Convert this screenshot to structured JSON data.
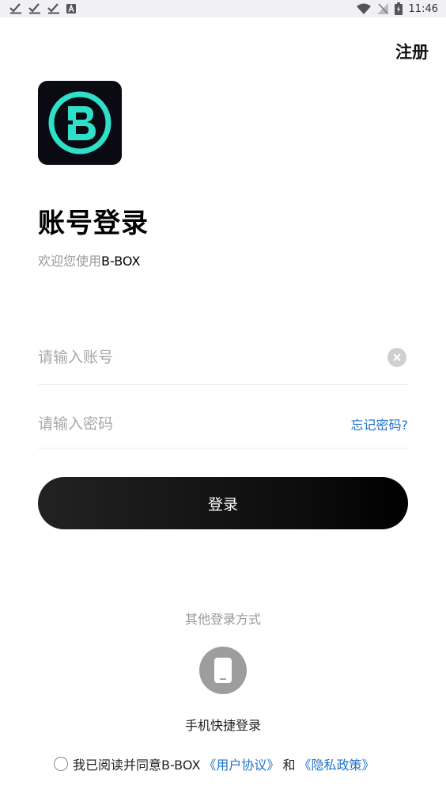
{
  "status_bar": {
    "time": "11:46",
    "icons": [
      "check-download-icon",
      "check-download-icon",
      "check-download-icon",
      "font-a-icon",
      "wifi-icon",
      "no-signal-icon",
      "battery-charging-icon"
    ]
  },
  "header": {
    "register_label": "注册"
  },
  "login": {
    "title": "账号登录",
    "welcome_prefix": "欢迎您使用",
    "brand": "B-BOX",
    "account_placeholder": "请输入账号",
    "password_placeholder": "请输入密码",
    "forgot_label": "忘记密码?",
    "login_button": "登录"
  },
  "other": {
    "label": "其他登录方式",
    "phone_label": "手机快捷登录"
  },
  "agreement": {
    "prefix": "我已阅读并同意B-BOX",
    "user_agreement": "《用户协议》",
    "and": "和",
    "privacy_policy": "《隐私政策》"
  },
  "colors": {
    "accent_link": "#1e73c8",
    "logo_bg": "#0a0a12",
    "logo_ring": "#2fe0c8"
  }
}
